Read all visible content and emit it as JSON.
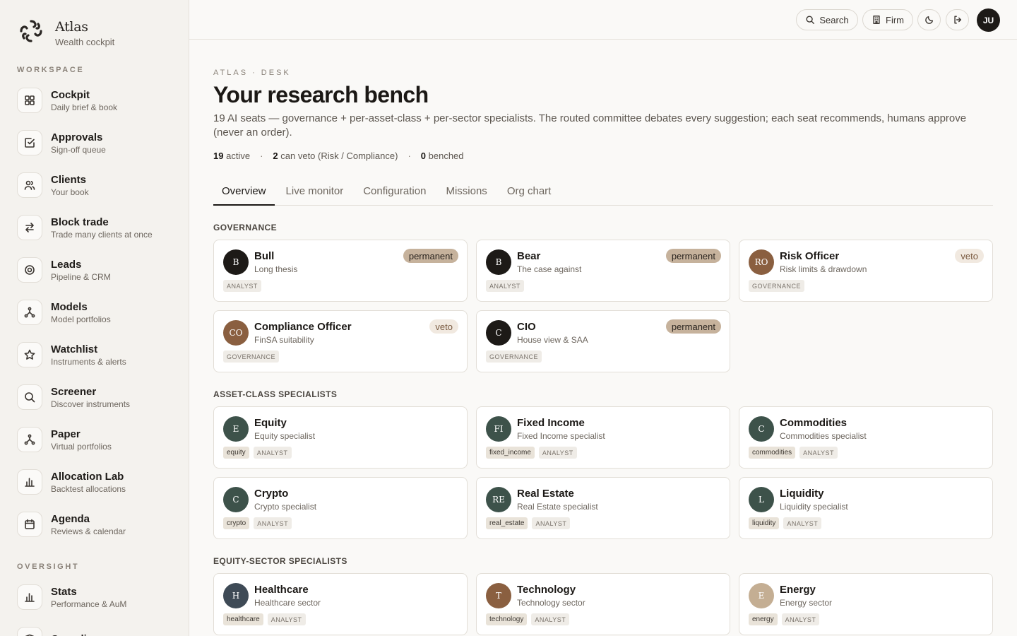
{
  "brand": {
    "name": "Atlas",
    "subtitle": "Wealth cockpit"
  },
  "sidebar": {
    "workspace_label": "WORKSPACE",
    "oversight_label": "OVERSIGHT",
    "items": [
      {
        "title": "Cockpit",
        "sub": "Daily brief & book",
        "icon": "grid-icon"
      },
      {
        "title": "Approvals",
        "sub": "Sign-off queue",
        "icon": "check-square-icon"
      },
      {
        "title": "Clients",
        "sub": "Your book",
        "icon": "users-icon"
      },
      {
        "title": "Block trade",
        "sub": "Trade many clients at once",
        "icon": "arrows-icon"
      },
      {
        "title": "Leads",
        "sub": "Pipeline & CRM",
        "icon": "target-icon"
      },
      {
        "title": "Models",
        "sub": "Model portfolios",
        "icon": "network-icon"
      },
      {
        "title": "Watchlist",
        "sub": "Instruments & alerts",
        "icon": "star-icon"
      },
      {
        "title": "Screener",
        "sub": "Discover instruments",
        "icon": "search-icon"
      },
      {
        "title": "Paper",
        "sub": "Virtual portfolios",
        "icon": "network-icon"
      },
      {
        "title": "Allocation Lab",
        "sub": "Backtest allocations",
        "icon": "bar-chart-icon"
      },
      {
        "title": "Agenda",
        "sub": "Reviews & calendar",
        "icon": "calendar-icon"
      }
    ],
    "oversight_items": [
      {
        "title": "Stats",
        "sub": "Performance & AuM",
        "icon": "bar-chart-icon"
      },
      {
        "title": "Compliance",
        "sub": "",
        "icon": "shield-icon"
      }
    ]
  },
  "topbar": {
    "search_label": "Search",
    "firm_label": "Firm",
    "avatar_initials": "JU"
  },
  "page": {
    "eyebrow": "ATLAS · DESK",
    "title": "Your research bench",
    "description": "19 AI seats — governance + per-asset-class + per-sector specialists. The routed committee debates every suggestion; each seat recommends, humans approve (never an order).",
    "stats": {
      "active_count": "19",
      "active_label": "active",
      "veto_count": "2",
      "veto_label": "can veto (Risk / Compliance)",
      "benched_count": "0",
      "benched_label": "benched",
      "separator": "·"
    },
    "tabs": [
      "Overview",
      "Live monitor",
      "Configuration",
      "Missions",
      "Org chart"
    ]
  },
  "groups": [
    {
      "label": "GOVERNANCE",
      "cards": [
        {
          "initials": "B",
          "name": "Bull",
          "sub": "Long thesis",
          "badge": "permanent",
          "tags": [],
          "role": "ANALYST",
          "avatar_color": "#1d1a17"
        },
        {
          "initials": "B",
          "name": "Bear",
          "sub": "The case against",
          "badge": "permanent",
          "tags": [],
          "role": "ANALYST",
          "avatar_color": "#1d1a17"
        },
        {
          "initials": "RO",
          "name": "Risk Officer",
          "sub": "Risk limits & drawdown",
          "badge": "veto",
          "tags": [],
          "role": "GOVERNANCE",
          "avatar_color": "#8a5f40"
        },
        {
          "initials": "CO",
          "name": "Compliance Officer",
          "sub": "FinSA suitability",
          "badge": "veto",
          "tags": [],
          "role": "GOVERNANCE",
          "avatar_color": "#8a5f40"
        },
        {
          "initials": "C",
          "name": "CIO",
          "sub": "House view & SAA",
          "badge": "permanent",
          "tags": [],
          "role": "GOVERNANCE",
          "avatar_color": "#1d1a17"
        }
      ]
    },
    {
      "label": "ASSET-CLASS SPECIALISTS",
      "cards": [
        {
          "initials": "E",
          "name": "Equity",
          "sub": "Equity specialist",
          "badge": "",
          "tags": [
            "equity"
          ],
          "role": "ANALYST",
          "avatar_color": "#3d524a"
        },
        {
          "initials": "FI",
          "name": "Fixed Income",
          "sub": "Fixed Income specialist",
          "badge": "",
          "tags": [
            "fixed_income"
          ],
          "role": "ANALYST",
          "avatar_color": "#3d524a"
        },
        {
          "initials": "C",
          "name": "Commodities",
          "sub": "Commodities specialist",
          "badge": "",
          "tags": [
            "commodities"
          ],
          "role": "ANALYST",
          "avatar_color": "#3d524a"
        },
        {
          "initials": "C",
          "name": "Crypto",
          "sub": "Crypto specialist",
          "badge": "",
          "tags": [
            "crypto"
          ],
          "role": "ANALYST",
          "avatar_color": "#3d524a"
        },
        {
          "initials": "RE",
          "name": "Real Estate",
          "sub": "Real Estate specialist",
          "badge": "",
          "tags": [
            "real_estate"
          ],
          "role": "ANALYST",
          "avatar_color": "#3d524a"
        },
        {
          "initials": "L",
          "name": "Liquidity",
          "sub": "Liquidity specialist",
          "badge": "",
          "tags": [
            "liquidity"
          ],
          "role": "ANALYST",
          "avatar_color": "#3d524a"
        }
      ]
    },
    {
      "label": "EQUITY-SECTOR SPECIALISTS",
      "cards": [
        {
          "initials": "H",
          "name": "Healthcare",
          "sub": "Healthcare sector",
          "badge": "",
          "tags": [
            "healthcare"
          ],
          "role": "ANALYST",
          "avatar_color": "#3e4a56"
        },
        {
          "initials": "T",
          "name": "Technology",
          "sub": "Technology sector",
          "badge": "",
          "tags": [
            "technology"
          ],
          "role": "ANALYST",
          "avatar_color": "#8a5f40"
        },
        {
          "initials": "E",
          "name": "Energy",
          "sub": "Energy sector",
          "badge": "",
          "tags": [
            "energy"
          ],
          "role": "ANALYST",
          "avatar_color": "#c4ae93"
        }
      ]
    }
  ]
}
